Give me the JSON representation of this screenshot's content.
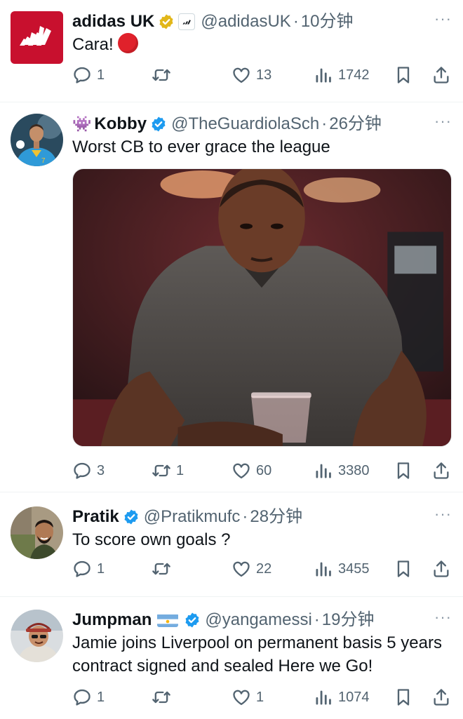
{
  "tweets": [
    {
      "name": "adidas UK",
      "handle": "@adidasUK",
      "dot": "·",
      "time": "10分钟",
      "more": "···",
      "text": "Cara!",
      "trailing_emoji": "red-circle",
      "badge": "gold-verified",
      "actions": {
        "replies": "1",
        "retweets": "",
        "likes": "13",
        "views": "1742"
      }
    },
    {
      "name": "Kobby",
      "name_emoji": "👾",
      "handle": "@TheGuardiolaSch",
      "dot": "·",
      "time": "26分钟",
      "more": "···",
      "text": "Worst CB to ever grace the league",
      "badge": "blue-verified",
      "actions": {
        "replies": "3",
        "retweets": "1",
        "likes": "60",
        "views": "3380"
      }
    },
    {
      "name": "Pratik",
      "handle": "@Pratikmufc",
      "dot": "·",
      "time": "28分钟",
      "more": "···",
      "text": "To score own goals ?",
      "badge": "blue-verified",
      "actions": {
        "replies": "1",
        "retweets": "",
        "likes": "22",
        "views": "3455"
      }
    },
    {
      "name": "Jumpman",
      "name_flag": "argentina-flag",
      "handle": "@yangamessi",
      "dot": "·",
      "time": "19分钟",
      "more": "···",
      "text": "Jamie joins Liverpool on permanent basis 5 years contract signed and sealed Here we Go!",
      "badge": "blue-verified",
      "actions": {
        "replies": "1",
        "retweets": "",
        "likes": "1",
        "views": "1074"
      }
    }
  ],
  "colors": {
    "text": "#0f1419",
    "secondary": "#536471",
    "verified_blue": "#1d9bf0",
    "verified_gold": "#e2b719",
    "adidas_red": "#c8102e",
    "divider": "#eff3f4"
  }
}
